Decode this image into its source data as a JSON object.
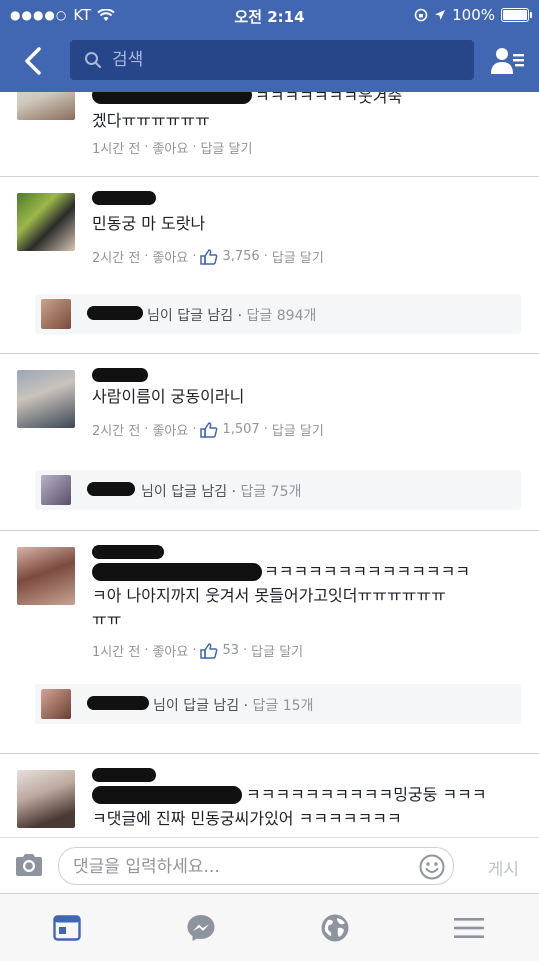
{
  "status": {
    "carrier": "KT",
    "time": "오전 2:14",
    "battery": "100%",
    "battery_level": 1.0
  },
  "search": {
    "placeholder": "검색"
  },
  "comments": [
    {
      "text": "겠다ㅠㅠㅠㅠㅠㅠ",
      "text_tail": "ㅋㅋㅋㅋㅋㅋㅋ웃겨죽",
      "time": "1시간 전",
      "like": "좋아요",
      "reply": "답글 달기"
    },
    {
      "text": "민동궁 마 도랏나",
      "time": "2시간 전",
      "like": "좋아요",
      "count": "3,756",
      "reply": "답글 달기",
      "replies": {
        "text": "님이 답글 남김",
        "count": "답글 894개"
      }
    },
    {
      "text": "사람이름이 궁동이라니",
      "time": "2시간 전",
      "like": "좋아요",
      "count": "1,507",
      "reply": "답글 달기",
      "replies": {
        "text": "님이 답글 남김",
        "count": "답글 75개"
      }
    },
    {
      "text_line1": "ㅋㅋㅋㅋㅋㅋㅋㅋㅋㅋㅋㅋㅋㅋ",
      "text_line2": "ㅋ아 나아지까지 웃겨서 못들어가고잇더ㅠㅠㅠㅠㅠㅠ",
      "text_line3": "ㅠㅠ",
      "time": "1시간 전",
      "like": "좋아요",
      "count": "53",
      "reply": "답글 달기",
      "replies": {
        "text": "님이 답글 남김",
        "count": "답글 15개"
      }
    },
    {
      "text_line1": "ㅋㅋㅋㅋㅋㅋㅋㅋㅋㅋ밍궁둥 ㅋㅋㅋ",
      "text_line2": "ㅋ댓글에 진짜 민동궁씨가있어 ㅋㅋㅋㅋㅋㅋㅋ"
    }
  ],
  "composer": {
    "placeholder": "댓글을 입력하세요...",
    "post_label": "게시"
  },
  "icons": {
    "back": "chevron-left-icon",
    "search": "search-icon",
    "friends": "friend-requests-icon",
    "camera": "camera-icon",
    "emoji": "emoji-icon",
    "like": "thumbs-up-icon",
    "tabs": [
      "news-feed-icon",
      "messenger-icon",
      "globe-icon",
      "menu-icon"
    ]
  },
  "colors": {
    "brand": "#4267b2",
    "active_tab": "#4267b2",
    "tab_inactive": "#8d949e"
  }
}
